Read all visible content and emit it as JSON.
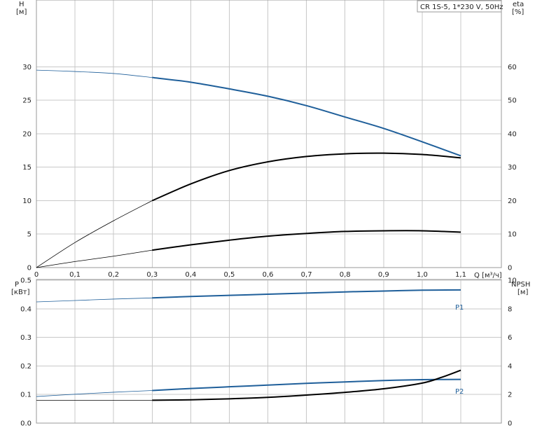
{
  "chart_data": {
    "title": "CR 1S-5, 1*230 V, 50Hz",
    "type": "line",
    "colors": {
      "blue": "#1f5f9a",
      "black": "#000000",
      "grid": "#c8c8c8"
    },
    "x_axis": {
      "label": "Q [м³/ч]",
      "range": [
        0,
        1.1
      ],
      "ticks": [
        0,
        0.1,
        0.2,
        0.3,
        0.4,
        0.5,
        0.6,
        0.7,
        0.8,
        0.9,
        1.0,
        1.1
      ],
      "tick_labels": [
        "0",
        "0,1",
        "0,2",
        "0,3",
        "0,4",
        "0,5",
        "0,6",
        "0,7",
        "0,8",
        "0,9",
        "1,0",
        "1,1"
      ]
    },
    "top_panel": {
      "left_axis": {
        "label": "H",
        "unit": "[м]",
        "range": [
          0,
          35
        ],
        "ticks": [
          0,
          5,
          10,
          15,
          20,
          25,
          30
        ],
        "tick_labels": [
          "0",
          "5",
          "10",
          "15",
          "20",
          "25",
          "30"
        ]
      },
      "right_axis": {
        "label": "eta",
        "unit": "[%]",
        "range": [
          0,
          70
        ],
        "ticks": [
          0,
          10,
          20,
          30,
          40,
          50,
          60
        ],
        "tick_labels": [
          "0",
          "10",
          "20",
          "30",
          "40",
          "50",
          "60"
        ]
      },
      "series": [
        {
          "axis": "left",
          "color": "#1f5f9a",
          "thin_before_x": 0.3,
          "x": [
            0,
            0.1,
            0.2,
            0.3,
            0.4,
            0.5,
            0.6,
            0.7,
            0.8,
            0.9,
            1.0,
            1.1
          ],
          "y": [
            29.5,
            29.3,
            29.0,
            28.4,
            27.7,
            26.7,
            25.6,
            24.2,
            22.5,
            20.8,
            18.8,
            16.7
          ]
        },
        {
          "axis": "right",
          "color": "#000000",
          "thin_before_x": 0.3,
          "x": [
            0,
            0.1,
            0.2,
            0.3,
            0.4,
            0.5,
            0.6,
            0.7,
            0.8,
            0.9,
            1.0,
            1.1
          ],
          "y": [
            0,
            7.5,
            14,
            20,
            25,
            29,
            31.6,
            33.2,
            34.0,
            34.2,
            33.8,
            32.8
          ]
        },
        {
          "axis": "left",
          "color": "#000000",
          "thin_before_x": 0.3,
          "x": [
            0,
            0.1,
            0.2,
            0.3,
            0.4,
            0.5,
            0.6,
            0.7,
            0.8,
            0.9,
            1.0,
            1.1
          ],
          "y": [
            0,
            0.9,
            1.7,
            2.6,
            3.4,
            4.1,
            4.7,
            5.1,
            5.4,
            5.5,
            5.5,
            5.3
          ]
        }
      ]
    },
    "bottom_panel": {
      "left_axis": {
        "label": "P",
        "unit": "[кВт]",
        "range": [
          0,
          0.5
        ],
        "ticks": [
          0,
          0.1,
          0.2,
          0.3,
          0.4,
          0.5
        ],
        "tick_labels": [
          "0.0",
          "0.1",
          "0.2",
          "0.3",
          "0.4",
          "0.5"
        ]
      },
      "right_axis": {
        "label": "NPSH",
        "unit": "[м]",
        "range": [
          0,
          10
        ],
        "ticks": [
          0,
          2,
          4,
          6,
          8,
          10
        ],
        "tick_labels": [
          "0",
          "2",
          "4",
          "6",
          "8",
          "10"
        ]
      },
      "series": [
        {
          "name": "P1",
          "axis": "left",
          "color": "#1f5f9a",
          "thin_before_x": 0.3,
          "x": [
            0,
            0.1,
            0.2,
            0.3,
            0.4,
            0.5,
            0.6,
            0.7,
            0.8,
            0.9,
            1.0,
            1.1
          ],
          "y": [
            0.424,
            0.429,
            0.434,
            0.438,
            0.443,
            0.447,
            0.451,
            0.455,
            0.459,
            0.462,
            0.465,
            0.466
          ]
        },
        {
          "name": "P2",
          "axis": "left",
          "color": "#1f5f9a",
          "thin_before_x": 0.3,
          "x": [
            0,
            0.1,
            0.2,
            0.3,
            0.4,
            0.5,
            0.6,
            0.7,
            0.8,
            0.9,
            1.0,
            1.1
          ],
          "y": [
            0.093,
            0.101,
            0.108,
            0.114,
            0.121,
            0.127,
            0.133,
            0.139,
            0.144,
            0.149,
            0.152,
            0.153
          ]
        },
        {
          "axis": "right",
          "color": "#000000",
          "thin_before_x": 0.3,
          "x": [
            0,
            0.3,
            0.4,
            0.5,
            0.6,
            0.7,
            0.8,
            0.9,
            1.0,
            1.05,
            1.1
          ],
          "y": [
            1.6,
            1.6,
            1.63,
            1.7,
            1.8,
            1.96,
            2.15,
            2.4,
            2.8,
            3.2,
            3.7
          ]
        }
      ]
    }
  }
}
